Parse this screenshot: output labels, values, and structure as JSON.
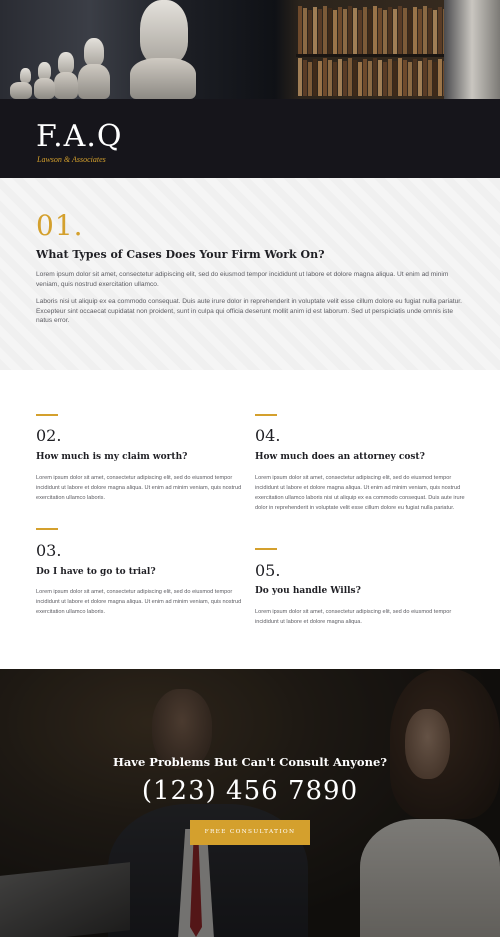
{
  "header": {
    "title": "F.A.Q",
    "subtitle": "Lawson & Associates"
  },
  "faq_main": {
    "number": "01.",
    "question": "What Types of Cases Does Your Firm Work On?",
    "paragraph_1": "Lorem ipsum dolor sit amet, consectetur adipiscing elit, sed do eiusmod tempor incididunt ut labore et dolore magna aliqua. Ut enim ad minim veniam, quis nostrud exercitation ullamco.",
    "paragraph_2": "Laboris nisi ut aliquip ex ea commodo consequat. Duis aute irure dolor in reprehenderit in voluptate velit esse cillum dolore eu fugiat nulla pariatur. Excepteur sint occaecat cupidatat non proident, sunt in culpa qui officia deserunt mollit anim id est laborum. Sed ut perspiciatis unde omnis iste natus error."
  },
  "faq_items": [
    {
      "number": "02.",
      "question": "How much is my claim worth?",
      "answer": "Lorem ipsum dolor sit amet, consectetur adipiscing elit, sed do eiusmod tempor incididunt ut labore et dolore magna aliqua. Ut enim ad minim veniam, quis nostrud exercitation ullamco laboris."
    },
    {
      "number": "03.",
      "question": "Do I have to go to trial?",
      "answer": "Lorem ipsum dolor sit amet, consectetur adipiscing elit, sed do eiusmod tempor incididunt ut labore et dolore magna aliqua. Ut enim ad minim veniam, quis nostrud exercitation ullamco laboris."
    },
    {
      "number": "04.",
      "question": "How much does an attorney cost?",
      "answer": "Lorem ipsum dolor sit amet, consectetur adipiscing elit, sed do eiusmod tempor incididunt ut labore et dolore magna aliqua. Ut enim ad minim veniam, quis nostrud exercitation ullamco laboris nisi ut aliquip ex ea commodo consequat. Duis aute irure dolor in reprehenderit in voluptate velit esse cillum dolore eu fugiat nulla pariatur."
    },
    {
      "number": "05.",
      "question": "Do you handle Wills?",
      "answer": "Lorem ipsum dolor sit amet, consectetur adipiscing elit, sed do eiusmod tempor incididunt ut labore et dolore magna aliqua."
    }
  ],
  "cta": {
    "title": "Have Problems But Can't Consult Anyone?",
    "phone": "(123) 456 7890",
    "button_label": "FREE CONSULTATION"
  },
  "colors": {
    "accent": "#d4a02d",
    "dark": "#16151b",
    "light_bg": "#f5f5f5"
  }
}
